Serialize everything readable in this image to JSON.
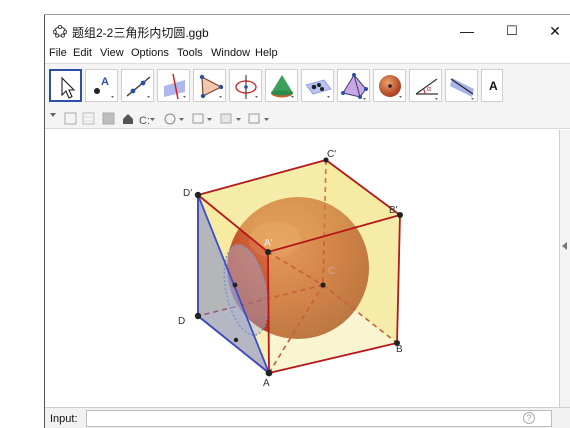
{
  "window": {
    "title": "题组2-2三角形内切圆.ggb",
    "controls": {
      "minimize": "—",
      "maximize": "☐",
      "close": "✕"
    }
  },
  "menu": [
    "File",
    "Edit",
    "View",
    "Options",
    "Tools",
    "Window",
    "Help"
  ],
  "toolbar": {
    "tools": [
      "move-tool",
      "point-tool",
      "line-tool",
      "perpendicular-line-tool",
      "polygon-tool",
      "circle-tool",
      "cone-tool",
      "intersect-tool",
      "reflect-tool",
      "pyramid-tool",
      "sphere-tool",
      "angle-tool",
      "plane-tool"
    ],
    "overflow_label": "A"
  },
  "scene": {
    "labels": {
      "C1": "C'",
      "D1": "D'",
      "B1": "B'",
      "A1": "A'",
      "C": "C",
      "D": "D",
      "B": "B",
      "A": "A"
    },
    "colors": {
      "cube_face": "#f2e27a",
      "cube_edge": "#b5181b",
      "sphere": "#c44a26",
      "triangle": "#7d8ad0",
      "triangle_edge": "#3b4fc9"
    }
  },
  "input": {
    "label": "Input:",
    "value": "",
    "help": "?"
  }
}
